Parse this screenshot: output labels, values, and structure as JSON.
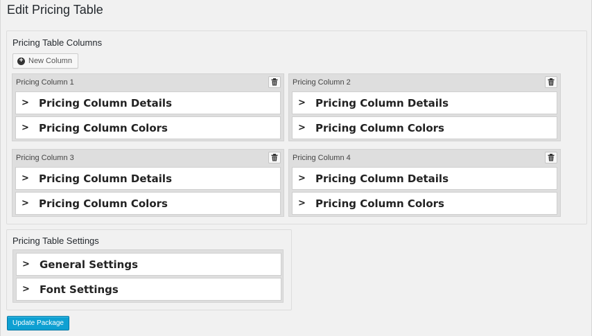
{
  "page": {
    "title": "Edit Pricing Table"
  },
  "columns_panel": {
    "title": "Pricing Table Columns",
    "new_column_label": "New Column",
    "columns": [
      {
        "name": "Pricing Column 1",
        "items": [
          "Pricing Column Details",
          "Pricing Column Colors"
        ]
      },
      {
        "name": "Pricing Column 2",
        "items": [
          "Pricing Column Details",
          "Pricing Column Colors"
        ]
      },
      {
        "name": "Pricing Column 3",
        "items": [
          "Pricing Column Details",
          "Pricing Column Colors"
        ]
      },
      {
        "name": "Pricing Column 4",
        "items": [
          "Pricing Column Details",
          "Pricing Column Colors"
        ]
      }
    ]
  },
  "settings_panel": {
    "title": "Pricing Table Settings",
    "items": [
      "General Settings",
      "Font Settings"
    ]
  },
  "update_button_label": "Update Package",
  "icons": {
    "new": "plus-circle-icon",
    "delete": "trash-icon",
    "expand": "chevron-right-icon"
  },
  "colors": {
    "primary_button": "#0ea0d2",
    "background": "#f1f1f1"
  }
}
